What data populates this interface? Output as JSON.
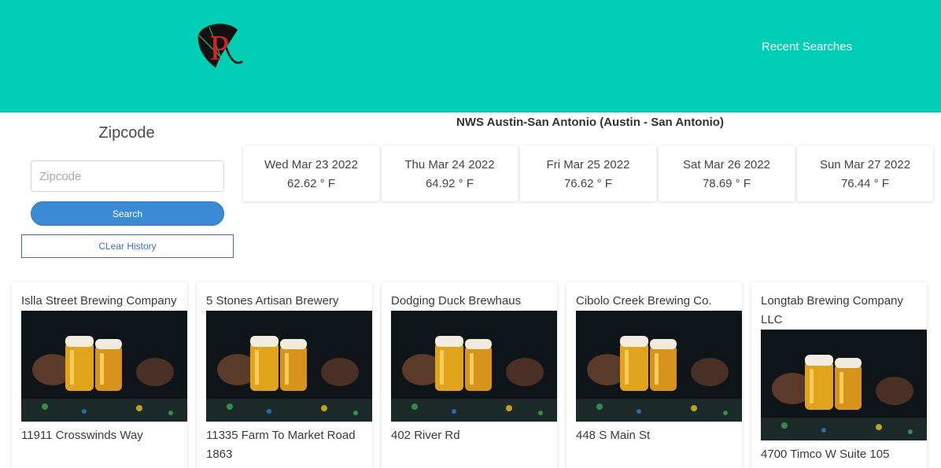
{
  "header": {
    "recent_searches": "Recent Searches",
    "logo_letter": "P",
    "bg_color": "#00cfb5"
  },
  "sidebar": {
    "title": "Zipcode",
    "input_placeholder": "Zipcode",
    "input_value": "",
    "search_label": "Search",
    "clear_label": "CLear History"
  },
  "weather": {
    "station": "NWS Austin-San Antonio (Austin - San Antonio)",
    "days": [
      {
        "date": "Wed Mar 23 2022",
        "temp": "62.62 ° F"
      },
      {
        "date": "Thu Mar 24 2022",
        "temp": "64.92 ° F"
      },
      {
        "date": "Fri Mar 25 2022",
        "temp": "76.62 ° F"
      },
      {
        "date": "Sat Mar 26 2022",
        "temp": "78.69 ° F"
      },
      {
        "date": "Sun Mar 27 2022",
        "temp": "76.44 ° F"
      }
    ]
  },
  "breweries": [
    {
      "name": "Islla Street Brewing Company",
      "address": "11911 Crosswinds Way"
    },
    {
      "name": "5 Stones Artisan Brewery",
      "address": "11335 Farm To Market Road 1863"
    },
    {
      "name": "Dodging Duck Brewhaus",
      "address": "402 River Rd"
    },
    {
      "name": "Cibolo Creek Brewing Co.",
      "address": "448 S Main St"
    },
    {
      "name": "Longtab Brewing Company LLC",
      "address": "4700 Timco W Suite 105"
    }
  ]
}
